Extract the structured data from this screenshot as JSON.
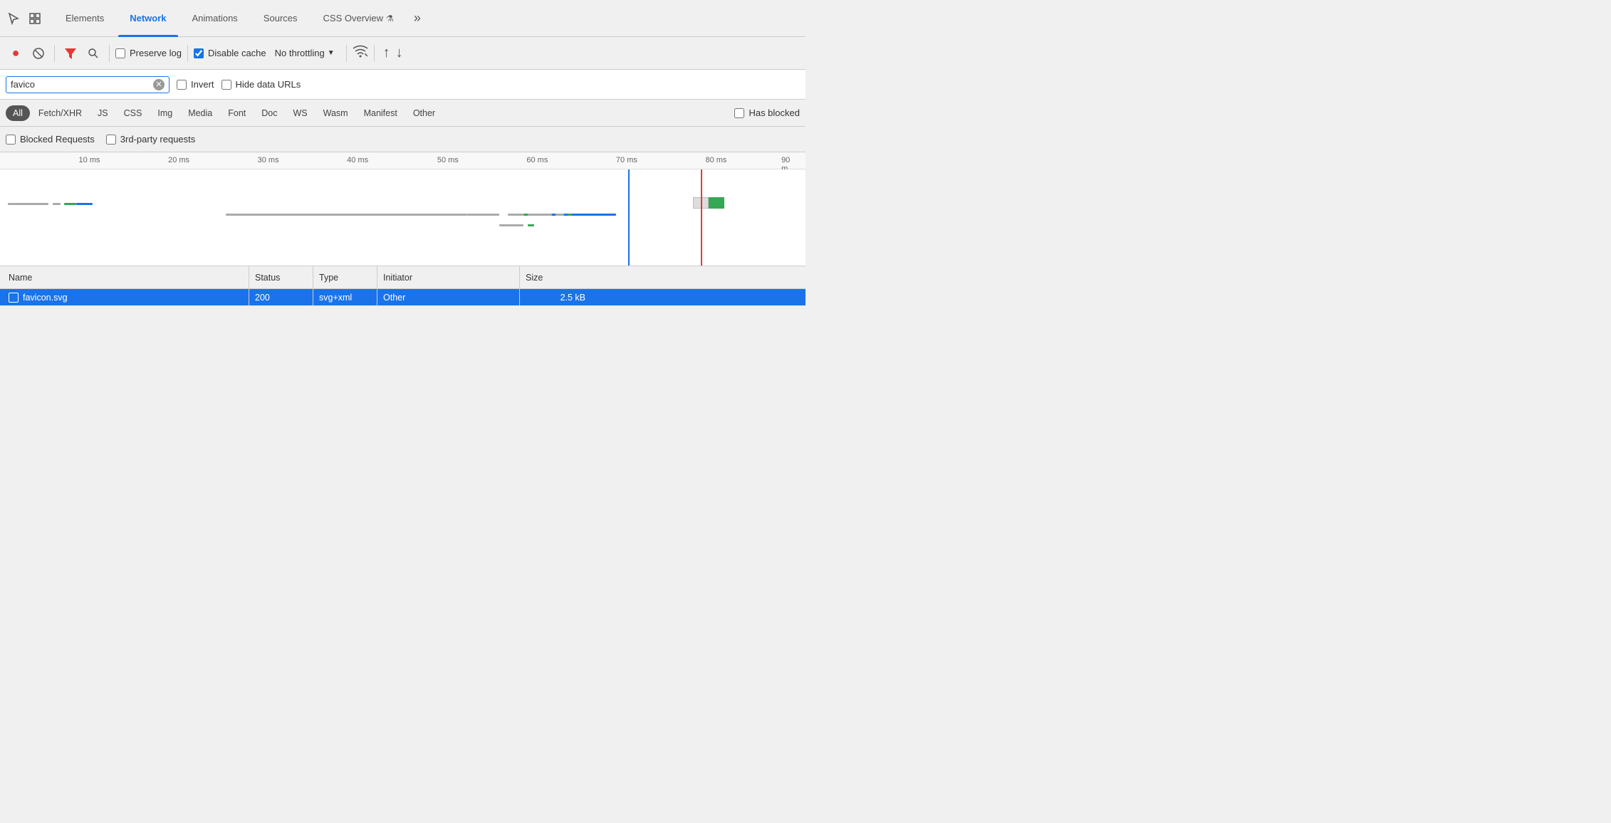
{
  "tabs": [
    {
      "id": "elements",
      "label": "Elements",
      "active": false
    },
    {
      "id": "network",
      "label": "Network",
      "active": true
    },
    {
      "id": "animations",
      "label": "Animations",
      "active": false
    },
    {
      "id": "sources",
      "label": "Sources",
      "active": false
    },
    {
      "id": "css-overview",
      "label": "CSS Overview",
      "active": false
    }
  ],
  "toolbar": {
    "record_label": "●",
    "cancel_label": "🚫",
    "filter_label": "▼",
    "search_label": "🔍",
    "preserve_log": "Preserve log",
    "disable_cache": "Disable cache",
    "no_throttling": "No throttling",
    "preserve_log_checked": false,
    "disable_cache_checked": true
  },
  "filter": {
    "search_value": "favico",
    "search_placeholder": "Filter",
    "invert_label": "Invert",
    "hide_data_urls_label": "Hide data URLs",
    "invert_checked": false,
    "hide_data_urls_checked": false
  },
  "type_filters": [
    {
      "id": "all",
      "label": "All",
      "active": true
    },
    {
      "id": "fetch-xhr",
      "label": "Fetch/XHR",
      "active": false
    },
    {
      "id": "js",
      "label": "JS",
      "active": false
    },
    {
      "id": "css",
      "label": "CSS",
      "active": false
    },
    {
      "id": "img",
      "label": "Img",
      "active": false
    },
    {
      "id": "media",
      "label": "Media",
      "active": false
    },
    {
      "id": "font",
      "label": "Font",
      "active": false
    },
    {
      "id": "doc",
      "label": "Doc",
      "active": false
    },
    {
      "id": "ws",
      "label": "WS",
      "active": false
    },
    {
      "id": "wasm",
      "label": "Wasm",
      "active": false
    },
    {
      "id": "manifest",
      "label": "Manifest",
      "active": false
    },
    {
      "id": "other",
      "label": "Other",
      "active": false
    }
  ],
  "has_blocked_label": "Has blocked",
  "blocked_requests_label": "Blocked Requests",
  "third_party_label": "3rd-party requests",
  "timeline": {
    "ticks": [
      "10 ms",
      "20 ms",
      "30 ms",
      "40 ms",
      "50 ms",
      "60 ms",
      "70 ms",
      "80 ms",
      "90 m"
    ]
  },
  "table": {
    "headers": {
      "name": "Name",
      "status": "Status",
      "type": "Type",
      "initiator": "Initiator",
      "size": "Size"
    },
    "rows": [
      {
        "name": "favicon.svg",
        "status": "200",
        "type": "svg+xml",
        "initiator": "Other",
        "size": "2.5 kB",
        "selected": true
      }
    ]
  },
  "colors": {
    "active_tab_line": "#1a73e8",
    "selected_row": "#1a73e8",
    "record_red": "#e53935",
    "blue_line": "#1a73e8",
    "red_line": "#e53935"
  }
}
